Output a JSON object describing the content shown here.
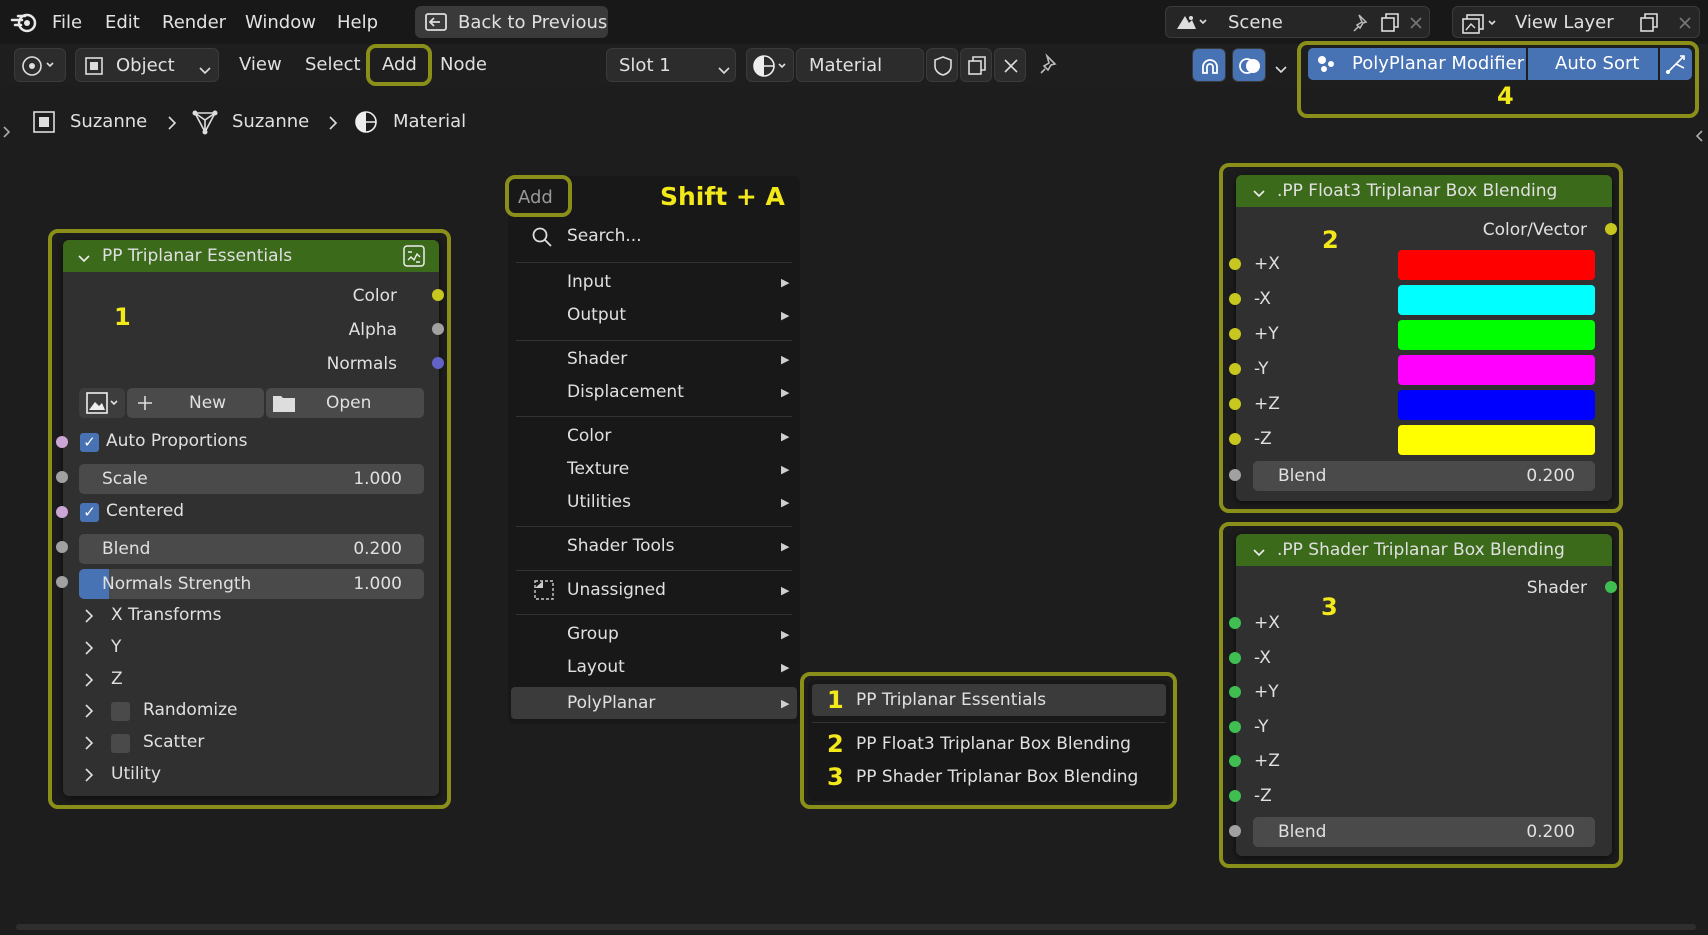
{
  "menubar": {
    "items": [
      "File",
      "Edit",
      "Render",
      "Window",
      "Help"
    ],
    "back_button": "Back to Previous",
    "scene": "Scene",
    "view_layer": "View Layer"
  },
  "header": {
    "mode": "Object",
    "view": "View",
    "select": "Select",
    "add": "Add",
    "node": "Node",
    "slot": "Slot 1",
    "material": "Material",
    "polyplanar_modifier": "PolyPlanar Modifier",
    "auto_sort": "Auto Sort",
    "callout_4": "4"
  },
  "breadcrumb": {
    "items": [
      "Suzanne",
      "Suzanne",
      "Material"
    ]
  },
  "node1": {
    "title": "PP Triplanar Essentials",
    "callout": "1",
    "outputs": [
      "Color",
      "Alpha",
      "Normals"
    ],
    "new_label": "New",
    "open_label": "Open",
    "auto_proportions": "Auto Proportions",
    "scale_label": "Scale",
    "scale_value": "1.000",
    "centered": "Centered",
    "blend_label": "Blend",
    "blend_value": "0.200",
    "normals_label": "Normals Strength",
    "normals_value": "1.000",
    "panels": [
      "X Transforms",
      "Y",
      "Z",
      "Randomize",
      "Scatter",
      "Utility"
    ]
  },
  "add_menu": {
    "title": "Add",
    "shortcut": "Shift + A",
    "search": "Search...",
    "items": [
      "Input",
      "Output",
      "Shader",
      "Displacement",
      "Color",
      "Texture",
      "Utilities",
      "Shader Tools",
      "Unassigned",
      "Group",
      "Layout",
      "PolyPlanar"
    ]
  },
  "submenu": {
    "items": [
      {
        "num": "1",
        "label": "PP Triplanar Essentials"
      },
      {
        "num": "2",
        "label": "PP Float3 Triplanar Box Blending"
      },
      {
        "num": "3",
        "label": "PP Shader Triplanar Box Blending"
      }
    ]
  },
  "node2": {
    "title": ".PP Float3 Triplanar Box Blending",
    "callout": "2",
    "output": "Color/Vector",
    "inputs": [
      "+X",
      "-X",
      "+Y",
      "-Y",
      "+Z",
      "-Z"
    ],
    "colors": [
      "#ff0000",
      "#00ffff",
      "#00ff00",
      "#ff00ff",
      "#0000ff",
      "#ffff00"
    ],
    "blend_label": "Blend",
    "blend_value": "0.200"
  },
  "node3": {
    "title": ".PP Shader Triplanar Box Blending",
    "callout": "3",
    "output": "Shader",
    "inputs": [
      "+X",
      "-X",
      "+Y",
      "-Y",
      "+Z",
      "-Z"
    ],
    "blend_label": "Blend",
    "blend_value": "0.200"
  }
}
